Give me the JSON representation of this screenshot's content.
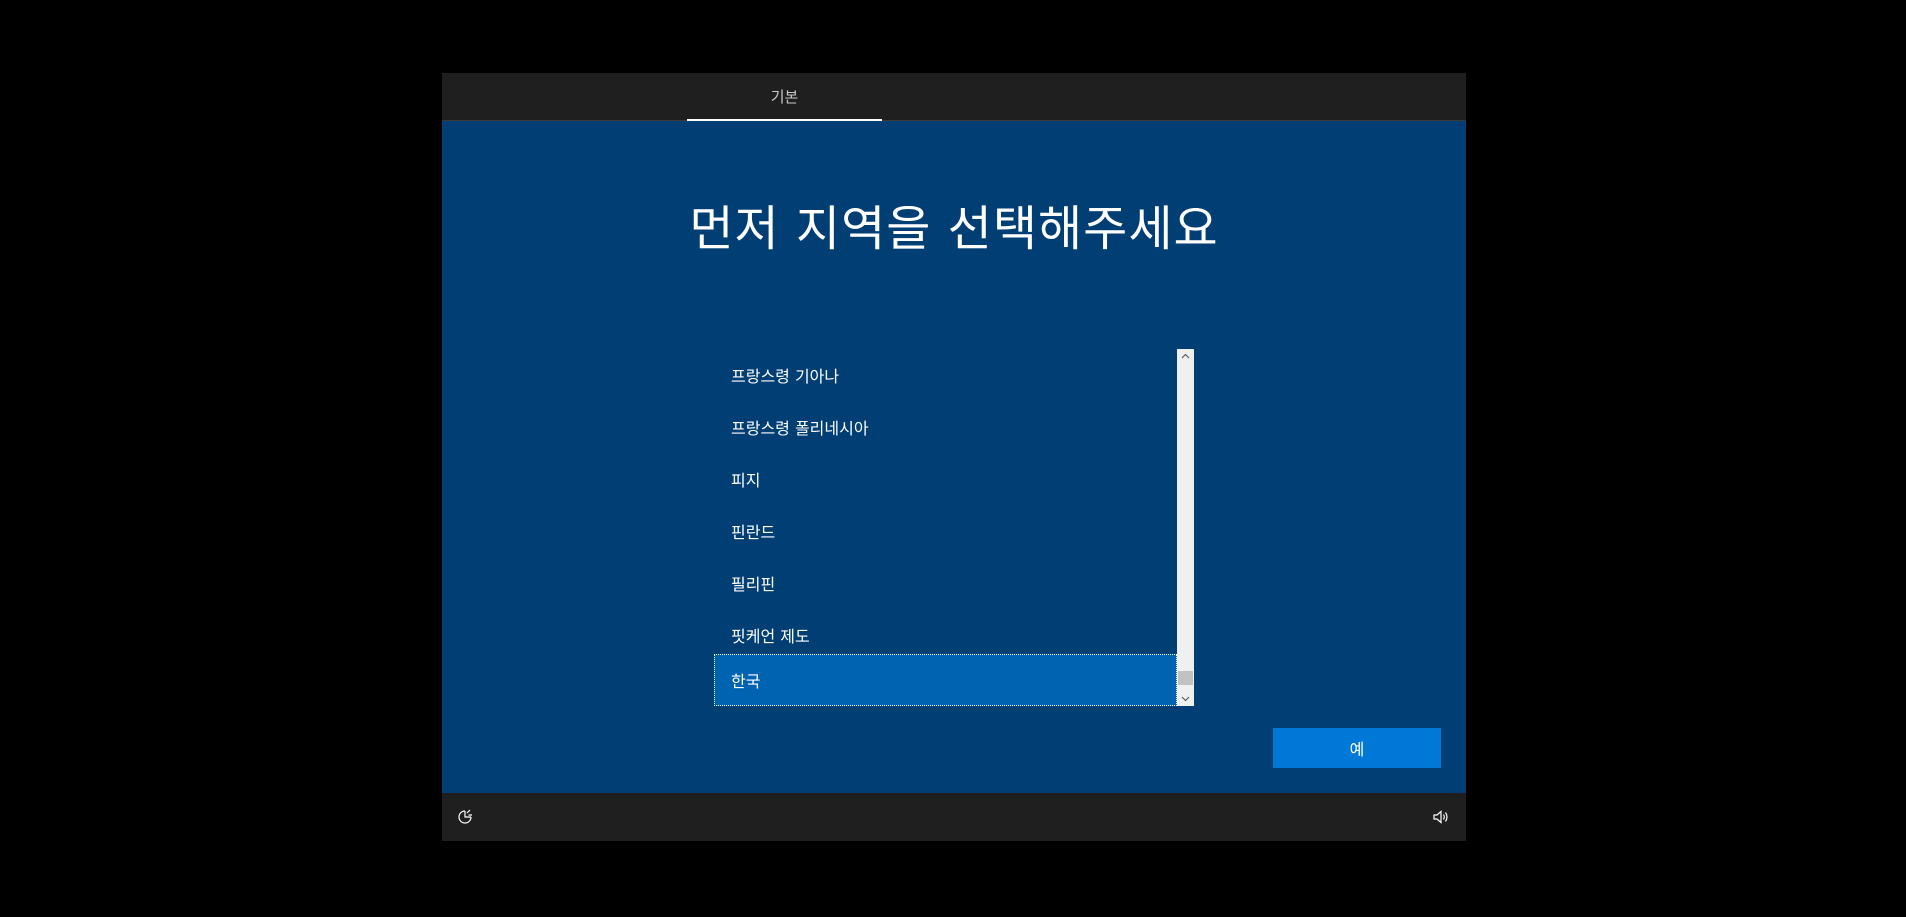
{
  "tabs": [
    {
      "label": "기본",
      "active": true
    }
  ],
  "title": "먼저 지역을 선택해주세요",
  "region_list": {
    "items": [
      {
        "label": "프랑스령 기아나"
      },
      {
        "label": "프랑스령 폴리네시아"
      },
      {
        "label": "피지"
      },
      {
        "label": "핀란드"
      },
      {
        "label": "필리핀"
      },
      {
        "label": "핏케언 제도"
      },
      {
        "label": "한국"
      }
    ],
    "selected_index": 6
  },
  "buttons": {
    "yes_label": "예"
  },
  "icons": {
    "scroll_up": "chevron-up-icon",
    "scroll_down": "chevron-down-icon",
    "accessibility": "ease-of-access-icon",
    "volume": "volume-icon"
  },
  "colors": {
    "background": "#000000",
    "panel": "#003e74",
    "bar": "#1f1f1f",
    "selection": "#0063b1",
    "accent_button": "#0078d7"
  }
}
